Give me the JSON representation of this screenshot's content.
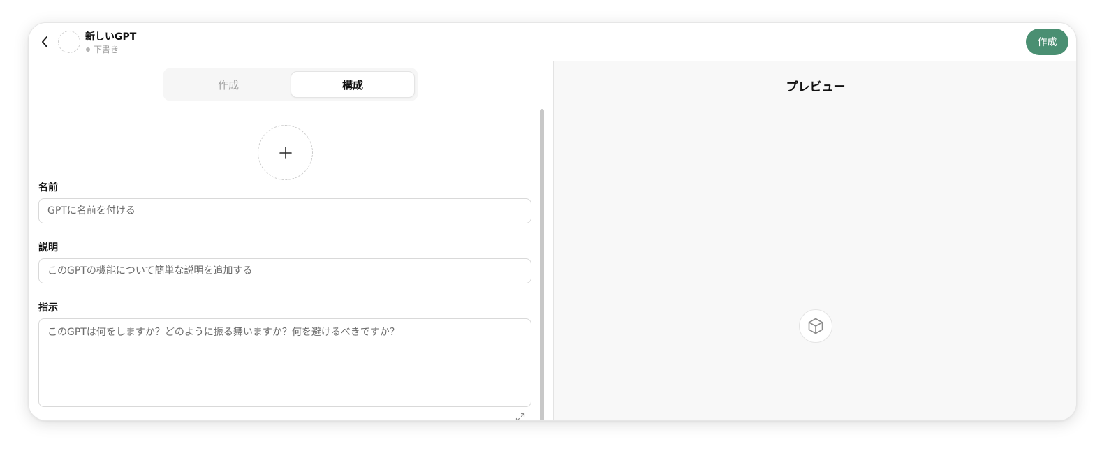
{
  "header": {
    "title": "新しいGPT",
    "status": "下書き",
    "create_button": "作成"
  },
  "tabs": [
    {
      "label": "作成",
      "selected": false
    },
    {
      "label": "構成",
      "selected": true
    }
  ],
  "form": {
    "name": {
      "label": "名前",
      "placeholder": "GPTに名前を付ける"
    },
    "description": {
      "label": "説明",
      "placeholder": "このGPTの機能について簡単な説明を追加する"
    },
    "instructions": {
      "label": "指示",
      "placeholder": "このGPTは何をしますか？どのように振る舞いますか？何を避けるべきですか？"
    }
  },
  "preview": {
    "title": "プレビュー"
  },
  "icons": {
    "back": "chevron-left-icon",
    "upload": "plus-icon",
    "expand": "expand-icon",
    "preview": "cube-icon"
  },
  "colors": {
    "accent": "#4a8f72"
  }
}
